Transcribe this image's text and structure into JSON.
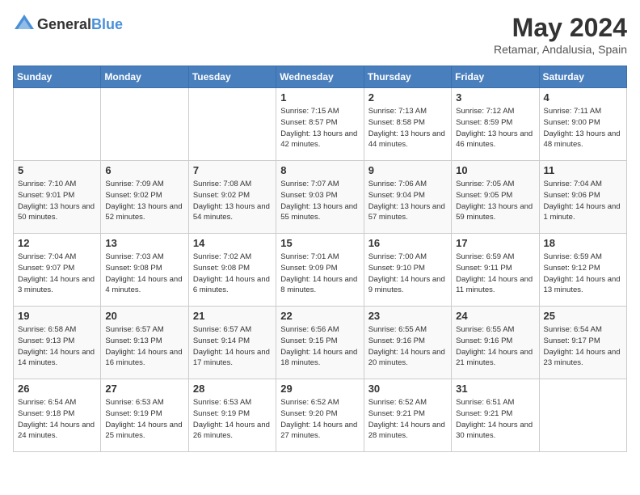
{
  "header": {
    "logo_general": "General",
    "logo_blue": "Blue",
    "month": "May 2024",
    "location": "Retamar, Andalusia, Spain"
  },
  "weekdays": [
    "Sunday",
    "Monday",
    "Tuesday",
    "Wednesday",
    "Thursday",
    "Friday",
    "Saturday"
  ],
  "weeks": [
    [
      {
        "day": "",
        "info": ""
      },
      {
        "day": "",
        "info": ""
      },
      {
        "day": "",
        "info": ""
      },
      {
        "day": "1",
        "info": "Sunrise: 7:15 AM\nSunset: 8:57 PM\nDaylight: 13 hours\nand 42 minutes."
      },
      {
        "day": "2",
        "info": "Sunrise: 7:13 AM\nSunset: 8:58 PM\nDaylight: 13 hours\nand 44 minutes."
      },
      {
        "day": "3",
        "info": "Sunrise: 7:12 AM\nSunset: 8:59 PM\nDaylight: 13 hours\nand 46 minutes."
      },
      {
        "day": "4",
        "info": "Sunrise: 7:11 AM\nSunset: 9:00 PM\nDaylight: 13 hours\nand 48 minutes."
      }
    ],
    [
      {
        "day": "5",
        "info": "Sunrise: 7:10 AM\nSunset: 9:01 PM\nDaylight: 13 hours\nand 50 minutes."
      },
      {
        "day": "6",
        "info": "Sunrise: 7:09 AM\nSunset: 9:02 PM\nDaylight: 13 hours\nand 52 minutes."
      },
      {
        "day": "7",
        "info": "Sunrise: 7:08 AM\nSunset: 9:02 PM\nDaylight: 13 hours\nand 54 minutes."
      },
      {
        "day": "8",
        "info": "Sunrise: 7:07 AM\nSunset: 9:03 PM\nDaylight: 13 hours\nand 55 minutes."
      },
      {
        "day": "9",
        "info": "Sunrise: 7:06 AM\nSunset: 9:04 PM\nDaylight: 13 hours\nand 57 minutes."
      },
      {
        "day": "10",
        "info": "Sunrise: 7:05 AM\nSunset: 9:05 PM\nDaylight: 13 hours\nand 59 minutes."
      },
      {
        "day": "11",
        "info": "Sunrise: 7:04 AM\nSunset: 9:06 PM\nDaylight: 14 hours\nand 1 minute."
      }
    ],
    [
      {
        "day": "12",
        "info": "Sunrise: 7:04 AM\nSunset: 9:07 PM\nDaylight: 14 hours\nand 3 minutes."
      },
      {
        "day": "13",
        "info": "Sunrise: 7:03 AM\nSunset: 9:08 PM\nDaylight: 14 hours\nand 4 minutes."
      },
      {
        "day": "14",
        "info": "Sunrise: 7:02 AM\nSunset: 9:08 PM\nDaylight: 14 hours\nand 6 minutes."
      },
      {
        "day": "15",
        "info": "Sunrise: 7:01 AM\nSunset: 9:09 PM\nDaylight: 14 hours\nand 8 minutes."
      },
      {
        "day": "16",
        "info": "Sunrise: 7:00 AM\nSunset: 9:10 PM\nDaylight: 14 hours\nand 9 minutes."
      },
      {
        "day": "17",
        "info": "Sunrise: 6:59 AM\nSunset: 9:11 PM\nDaylight: 14 hours\nand 11 minutes."
      },
      {
        "day": "18",
        "info": "Sunrise: 6:59 AM\nSunset: 9:12 PM\nDaylight: 14 hours\nand 13 minutes."
      }
    ],
    [
      {
        "day": "19",
        "info": "Sunrise: 6:58 AM\nSunset: 9:13 PM\nDaylight: 14 hours\nand 14 minutes."
      },
      {
        "day": "20",
        "info": "Sunrise: 6:57 AM\nSunset: 9:13 PM\nDaylight: 14 hours\nand 16 minutes."
      },
      {
        "day": "21",
        "info": "Sunrise: 6:57 AM\nSunset: 9:14 PM\nDaylight: 14 hours\nand 17 minutes."
      },
      {
        "day": "22",
        "info": "Sunrise: 6:56 AM\nSunset: 9:15 PM\nDaylight: 14 hours\nand 18 minutes."
      },
      {
        "day": "23",
        "info": "Sunrise: 6:55 AM\nSunset: 9:16 PM\nDaylight: 14 hours\nand 20 minutes."
      },
      {
        "day": "24",
        "info": "Sunrise: 6:55 AM\nSunset: 9:16 PM\nDaylight: 14 hours\nand 21 minutes."
      },
      {
        "day": "25",
        "info": "Sunrise: 6:54 AM\nSunset: 9:17 PM\nDaylight: 14 hours\nand 23 minutes."
      }
    ],
    [
      {
        "day": "26",
        "info": "Sunrise: 6:54 AM\nSunset: 9:18 PM\nDaylight: 14 hours\nand 24 minutes."
      },
      {
        "day": "27",
        "info": "Sunrise: 6:53 AM\nSunset: 9:19 PM\nDaylight: 14 hours\nand 25 minutes."
      },
      {
        "day": "28",
        "info": "Sunrise: 6:53 AM\nSunset: 9:19 PM\nDaylight: 14 hours\nand 26 minutes."
      },
      {
        "day": "29",
        "info": "Sunrise: 6:52 AM\nSunset: 9:20 PM\nDaylight: 14 hours\nand 27 minutes."
      },
      {
        "day": "30",
        "info": "Sunrise: 6:52 AM\nSunset: 9:21 PM\nDaylight: 14 hours\nand 28 minutes."
      },
      {
        "day": "31",
        "info": "Sunrise: 6:51 AM\nSunset: 9:21 PM\nDaylight: 14 hours\nand 30 minutes."
      },
      {
        "day": "",
        "info": ""
      }
    ]
  ]
}
